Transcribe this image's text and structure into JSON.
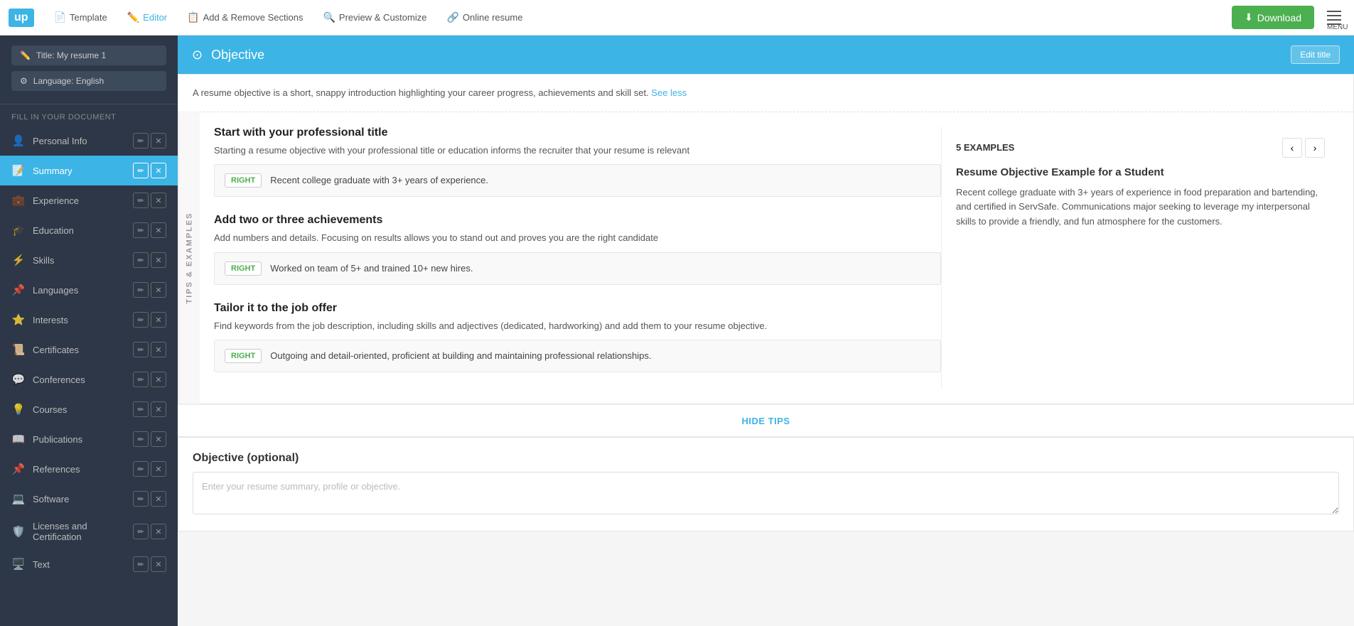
{
  "nav": {
    "logo": "up",
    "items": [
      {
        "id": "template",
        "label": "Template",
        "icon": "📄",
        "active": false
      },
      {
        "id": "editor",
        "label": "Editor",
        "icon": "✏️",
        "active": true
      },
      {
        "id": "add-remove",
        "label": "Add & Remove Sections",
        "icon": "📋",
        "active": false
      },
      {
        "id": "preview",
        "label": "Preview & Customize",
        "icon": "🔍",
        "active": false
      },
      {
        "id": "online-resume",
        "label": "Online resume",
        "icon": "🔗",
        "active": false
      }
    ],
    "download_label": "Download",
    "menu_label": "MENU"
  },
  "sidebar": {
    "title_btn": "Title: My resume 1",
    "language_btn": "Language: English",
    "fill_label": "FILL IN YOUR DOCUMENT",
    "items": [
      {
        "id": "personal-info",
        "label": "Personal Info",
        "icon": "👤",
        "active": false,
        "has_actions": true
      },
      {
        "id": "summary",
        "label": "Summary",
        "icon": "📝",
        "active": true,
        "has_actions": true
      },
      {
        "id": "experience",
        "label": "Experience",
        "icon": "💼",
        "active": false,
        "has_actions": true
      },
      {
        "id": "education",
        "label": "Education",
        "icon": "🎓",
        "active": false,
        "has_actions": true
      },
      {
        "id": "skills",
        "label": "Skills",
        "icon": "⚡",
        "active": false,
        "has_actions": true
      },
      {
        "id": "languages",
        "label": "Languages",
        "icon": "📌",
        "active": false,
        "has_actions": true
      },
      {
        "id": "interests",
        "label": "Interests",
        "icon": "⭐",
        "active": false,
        "has_actions": true
      },
      {
        "id": "certificates",
        "label": "Certificates",
        "icon": "📜",
        "active": false,
        "has_actions": true
      },
      {
        "id": "conferences",
        "label": "Conferences",
        "icon": "💬",
        "active": false,
        "has_actions": true
      },
      {
        "id": "courses",
        "label": "Courses",
        "icon": "💡",
        "active": false,
        "has_actions": true
      },
      {
        "id": "publications",
        "label": "Publications",
        "icon": "📖",
        "active": false,
        "has_actions": true
      },
      {
        "id": "references",
        "label": "References",
        "icon": "📌",
        "active": false,
        "has_actions": true
      },
      {
        "id": "software",
        "label": "Software",
        "icon": "💻",
        "active": false,
        "has_actions": true
      },
      {
        "id": "licenses",
        "label": "Licenses and Certification",
        "icon": "🛡️",
        "active": false,
        "has_actions": true
      },
      {
        "id": "text",
        "label": "Text",
        "icon": "🖥️",
        "active": false,
        "has_actions": true
      }
    ]
  },
  "main": {
    "section_title": "Objective",
    "edit_title_label": "Edit title",
    "tips_intro": "A resume objective is a short, snappy introduction highlighting your career progress, achievements and skill set.",
    "see_less_label": "See less",
    "tips_vertical_label": "TIPS & EXAMPLES",
    "tip_blocks": [
      {
        "title": "Start with your professional title",
        "desc": "Starting a resume objective with your professional title or education informs the recruiter that your resume is relevant",
        "right_label": "RIGHT",
        "right_text": "Recent college graduate with 3+ years of experience."
      },
      {
        "title": "Add two or three achievements",
        "desc": "Add numbers and details. Focusing on results allows you to stand out and proves you are the right candidate",
        "right_label": "RIGHT",
        "right_text": "Worked on team of 5+ and trained 10+ new hires."
      },
      {
        "title": "Tailor it to the job offer",
        "desc": "Find keywords from the job description, including skills and adjectives (dedicated, hardworking) and add them to your resume objective.",
        "right_label": "RIGHT",
        "right_text": "Outgoing and detail-oriented, proficient at building and maintaining professional relationships."
      }
    ],
    "examples": {
      "count_label": "5 EXAMPLES",
      "prev_icon": "‹",
      "next_icon": "›",
      "card_title": "Resume Objective Example for a Student",
      "card_text": "Recent college graduate with 3+ years of experience in food preparation and bartending, and certified in ServSafe. Communications major seeking to leverage my interpersonal skills to provide a friendly, and fun atmosphere for the customers."
    },
    "hide_tips_label": "HIDE TIPS",
    "objective_section_title": "Objective (optional)",
    "objective_placeholder": "Enter your resume summary, profile or objective."
  }
}
